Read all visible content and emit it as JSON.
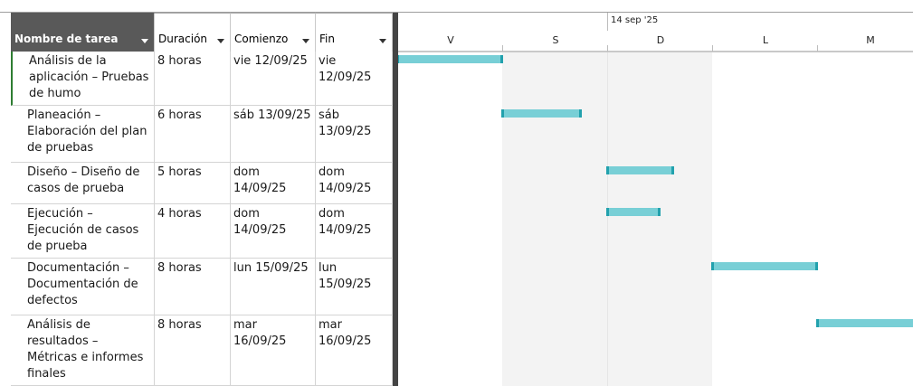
{
  "columns": {
    "name": "Nombre de tarea",
    "duration": "Duración",
    "start": "Comienzo",
    "finish": "Fin"
  },
  "tasks": [
    {
      "name": [
        "Análisis de la",
        "aplicación – Pruebas",
        "de humo"
      ],
      "duration": "8 horas",
      "start": [
        "vie 12/09/25"
      ],
      "finish": [
        "vie 12/09/25"
      ]
    },
    {
      "name": [
        "Planeación –",
        "Elaboración del plan",
        "de pruebas"
      ],
      "duration": "6 horas",
      "start": [
        "sáb 13/09/25"
      ],
      "finish": [
        "sáb",
        "13/09/25"
      ]
    },
    {
      "name": [
        "Diseño – Diseño de",
        "casos de prueba"
      ],
      "duration": "5 horas",
      "start": [
        "dom",
        "14/09/25"
      ],
      "finish": [
        "dom",
        "14/09/25"
      ]
    },
    {
      "name": [
        "Ejecución –",
        "Ejecución de casos",
        "de prueba"
      ],
      "duration": "4 horas",
      "start": [
        "dom",
        "14/09/25"
      ],
      "finish": [
        "dom",
        "14/09/25"
      ]
    },
    {
      "name": [
        "Documentación –",
        "Documentación de",
        "defectos"
      ],
      "duration": "8 horas",
      "start": [
        "lun 15/09/25"
      ],
      "finish": [
        "lun",
        "15/09/25"
      ]
    },
    {
      "name": [
        "Análisis de",
        "resultados –",
        "Métricas e informes",
        "finales"
      ],
      "duration": "8 horas",
      "start": [
        "mar 16/09/25"
      ],
      "finish": [
        "mar",
        "16/09/25"
      ]
    }
  ],
  "timescale": {
    "week_label": "14 sep '25",
    "days": [
      "V",
      "S",
      "D",
      "L",
      "M"
    ]
  },
  "bars": [
    {
      "task": 0,
      "day": 0,
      "hours": 8
    },
    {
      "task": 1,
      "day": 1,
      "hours": 6
    },
    {
      "task": 2,
      "day": 2,
      "hours": 5
    },
    {
      "task": 3,
      "day": 2,
      "hours": 4
    },
    {
      "task": 4,
      "day": 3,
      "hours": 8
    },
    {
      "task": 5,
      "day": 4,
      "hours": 8
    }
  ],
  "colors": {
    "bar_fill": "#78cfd6",
    "bar_end": "#22a1ad",
    "header_selected": "#595959",
    "weekend": "#f3f3f3"
  }
}
